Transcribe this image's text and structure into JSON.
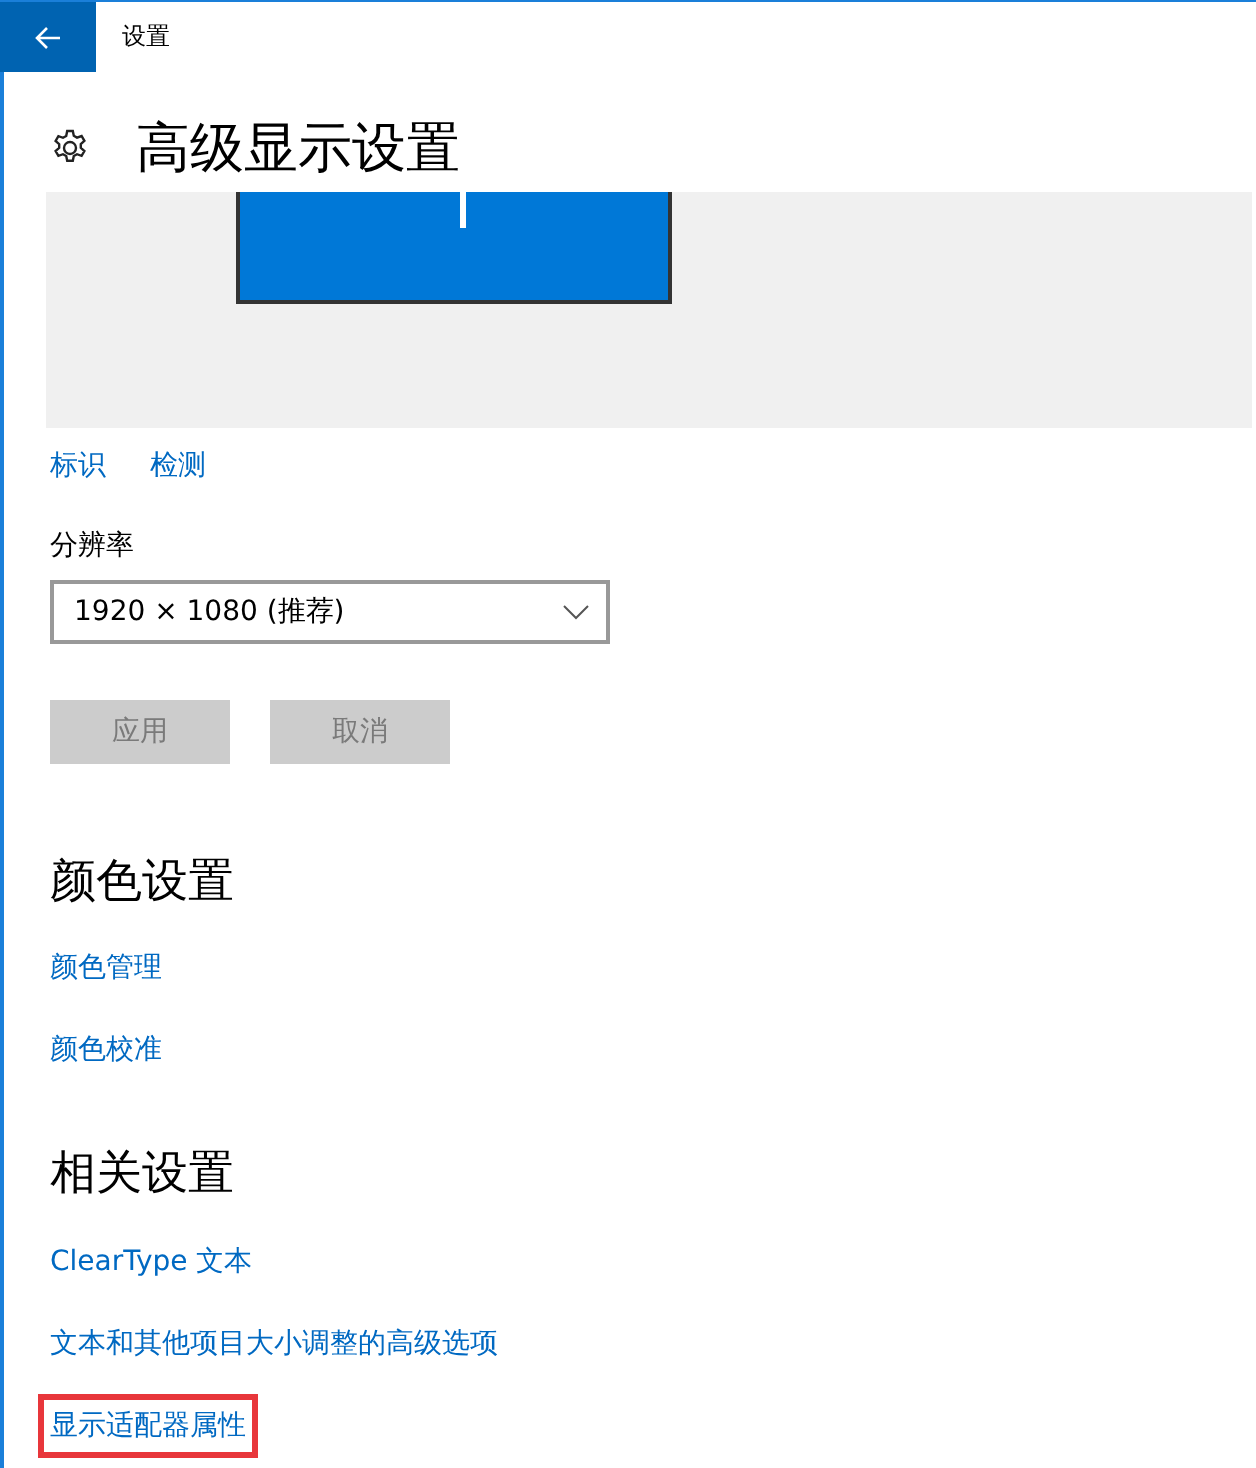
{
  "window": {
    "title": "设置"
  },
  "page": {
    "title": "高级显示设置"
  },
  "display_preview": {
    "links": [
      {
        "label": "标识"
      },
      {
        "label": "检测"
      }
    ]
  },
  "resolution": {
    "label": "分辨率",
    "value": "1920 × 1080 (推荐)"
  },
  "buttons": [
    {
      "label": "应用",
      "disabled": true
    },
    {
      "label": "取消",
      "disabled": true
    }
  ],
  "sections": [
    {
      "heading": "颜色设置",
      "links": [
        {
          "label": "颜色管理",
          "highlighted": false
        },
        {
          "label": "颜色校准",
          "highlighted": false
        }
      ]
    },
    {
      "heading": "相关设置",
      "links": [
        {
          "label": "ClearType 文本",
          "highlighted": false
        },
        {
          "label": "文本和其他项目大小调整的高级选项",
          "highlighted": false
        },
        {
          "label": "显示适配器属性",
          "highlighted": true
        }
      ]
    }
  ]
}
